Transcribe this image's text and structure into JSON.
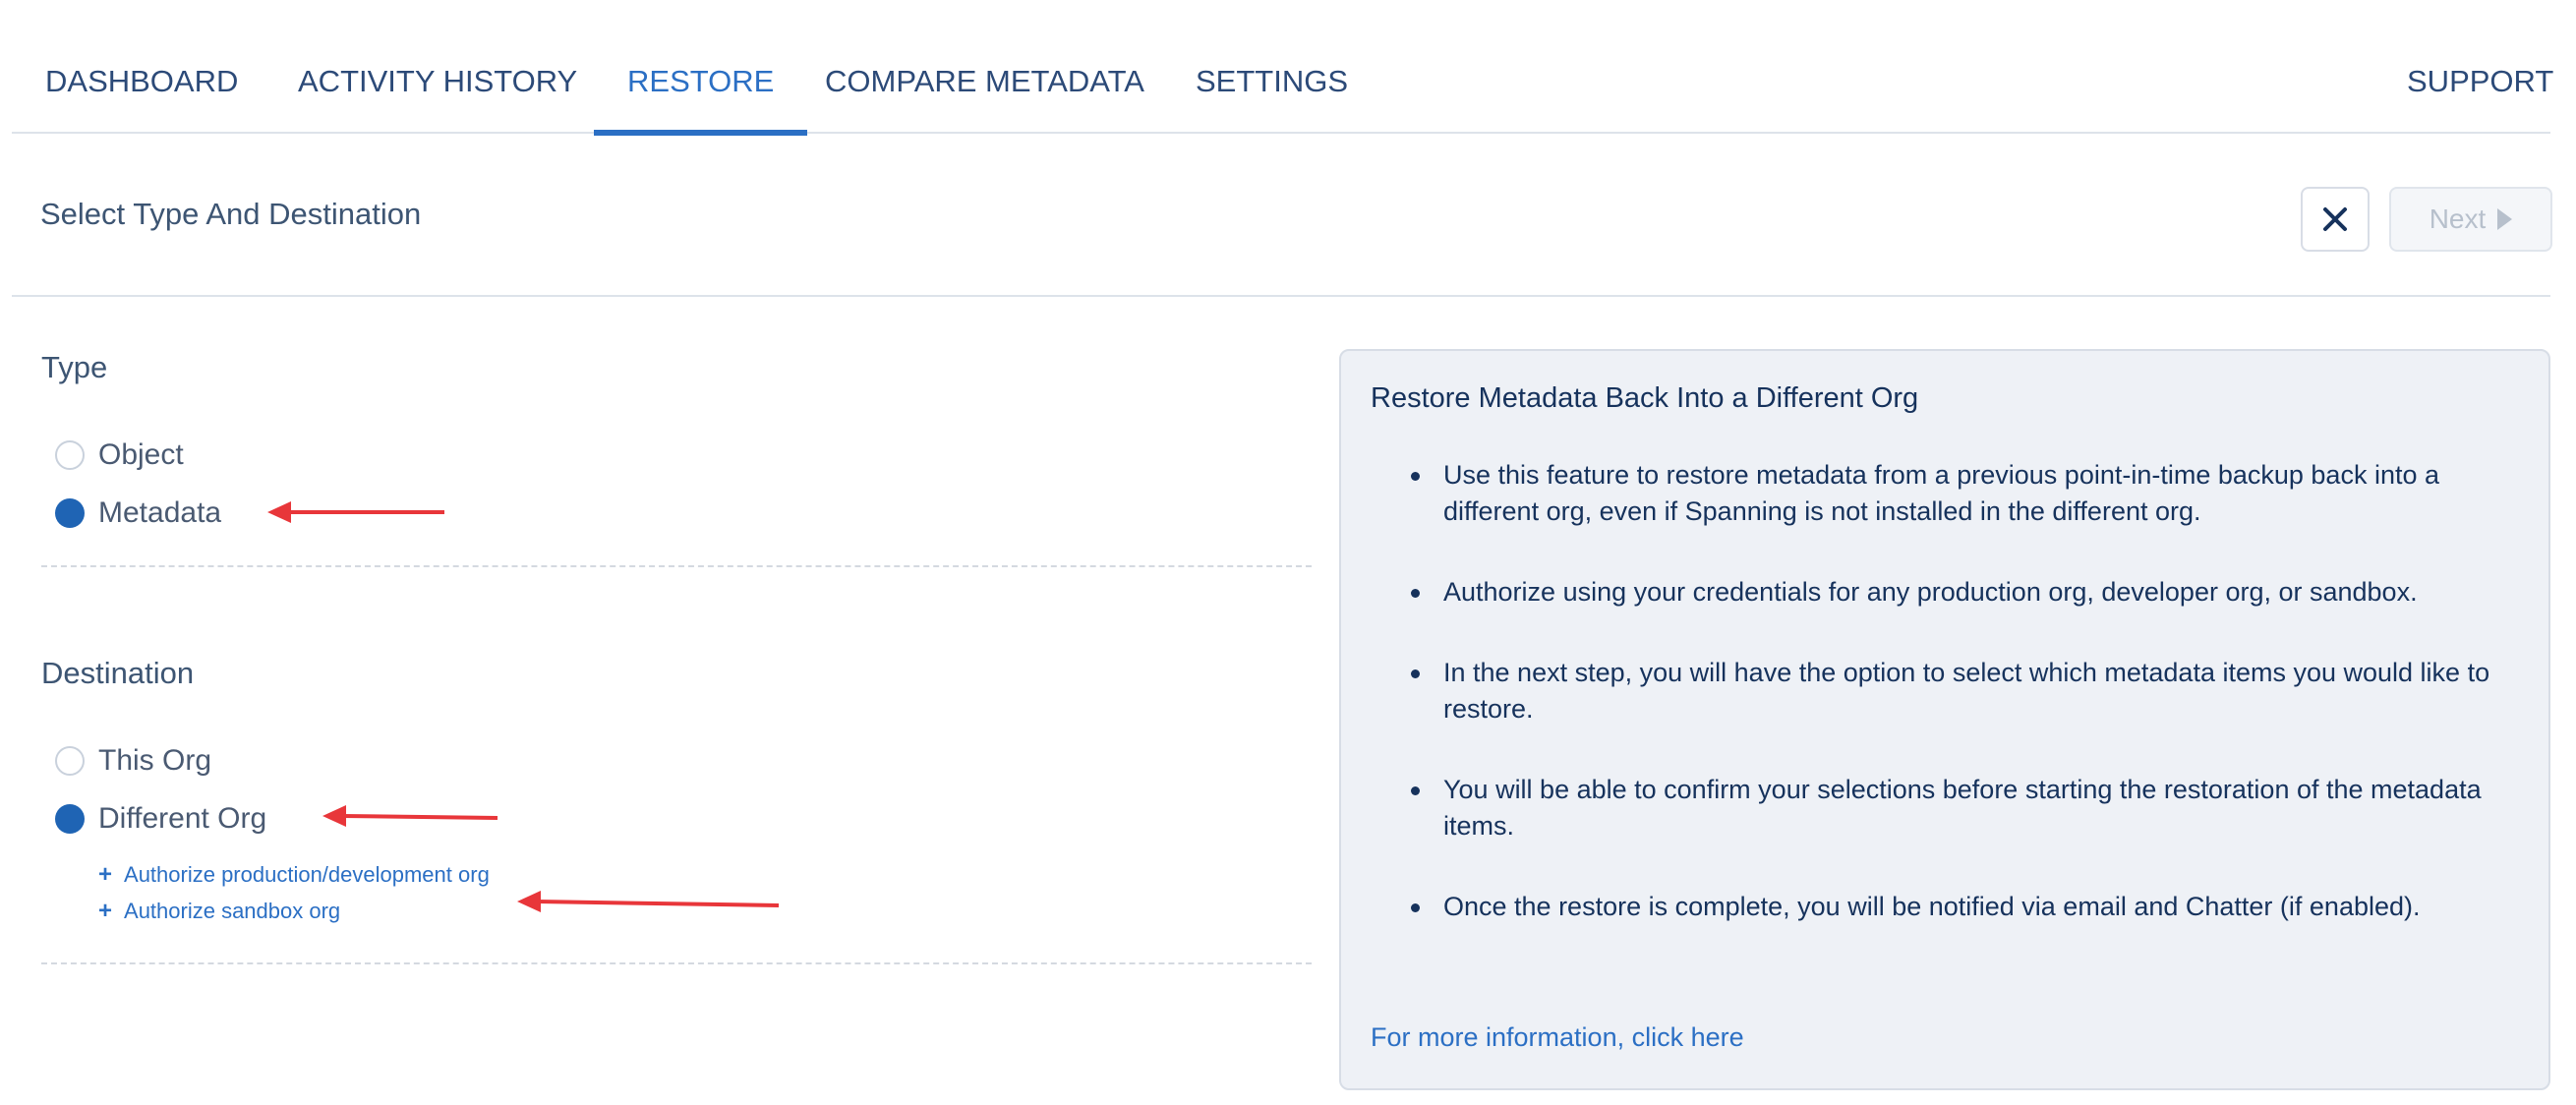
{
  "nav": {
    "tabs": [
      {
        "label": "DASHBOARD"
      },
      {
        "label": "ACTIVITY HISTORY"
      },
      {
        "label": "RESTORE"
      },
      {
        "label": "COMPARE METADATA"
      },
      {
        "label": "SETTINGS"
      }
    ],
    "active_tab": "RESTORE",
    "support_label": "SUPPORT"
  },
  "header": {
    "title": "Select Type And Destination",
    "close_icon": "close-icon",
    "next_label": "Next",
    "next_icon": "play-icon"
  },
  "type_section": {
    "label": "Type",
    "options": [
      {
        "label": "Object",
        "selected": false
      },
      {
        "label": "Metadata",
        "selected": true
      }
    ]
  },
  "destination_section": {
    "label": "Destination",
    "options": [
      {
        "label": "This Org",
        "selected": false
      },
      {
        "label": "Different Org",
        "selected": true
      }
    ],
    "links": [
      {
        "label": "Authorize production/development org"
      },
      {
        "label": "Authorize sandbox org"
      }
    ]
  },
  "info_panel": {
    "title": "Restore Metadata Back Into a Different Org",
    "bullets": [
      "Use this feature to restore metadata from a previous point-in-time backup back into a different org, even if Spanning is not installed in the different org.",
      "Authorize using your credentials for any production org, developer org, or sandbox.",
      "In the next step, you will have the option to select which metadata items you would like to restore.",
      "You will be able to confirm your selections before starting the restoration of the metadata items.",
      "Once the restore is complete, you will be notified via email and Chatter (if enabled)."
    ],
    "more_info_link": "For more information, click here"
  },
  "colors": {
    "accent": "#2b6fc4",
    "radio_selected": "#1f64b4",
    "annotation_arrow": "#e8363a",
    "panel_background": "#eef1f6"
  }
}
